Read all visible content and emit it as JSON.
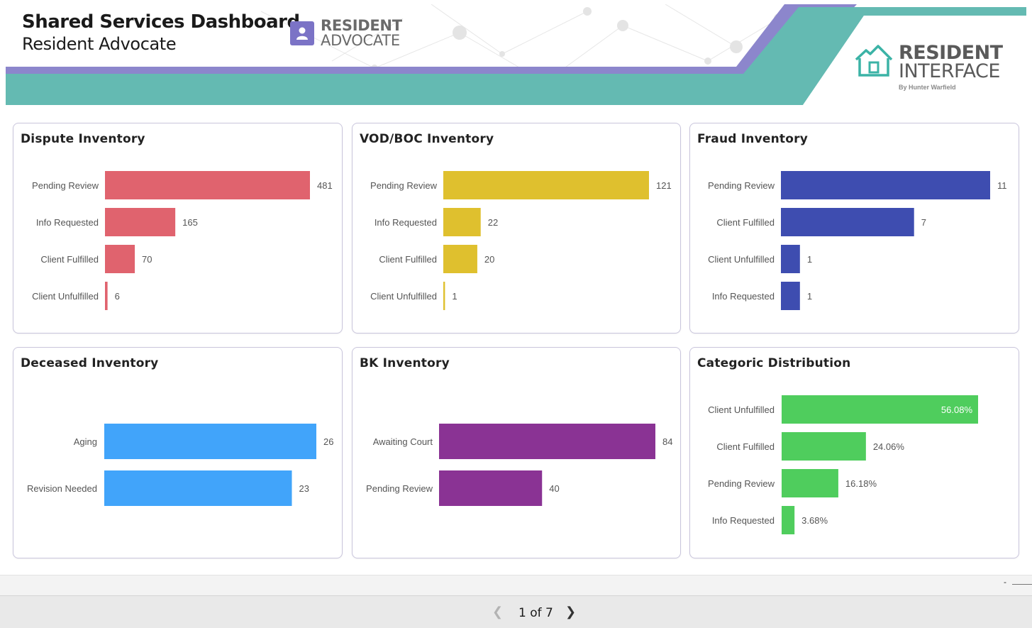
{
  "header": {
    "title": "Shared Services Dashboard",
    "subtitle": "Resident Advocate",
    "ra_logo": {
      "line1": "RESIDENT",
      "line2": "ADVOCATE",
      "icon": "user-badge-icon"
    },
    "ri_logo": {
      "line1": "RESIDENT",
      "line2": "INTERFACE",
      "tagline": "By Hunter Warfield",
      "icon": "house-icon"
    },
    "colors": {
      "purple_band": "#8c86cc",
      "teal_band": "#64bab2"
    }
  },
  "cards": [
    {
      "title": "Dispute Inventory",
      "chart_data": {
        "type": "bar",
        "orientation": "horizontal",
        "color": "#e0636e",
        "categories": [
          "Pending Review",
          "Info Requested",
          "Client Fulfilled",
          "Client Unfulfilled"
        ],
        "values": [
          481,
          165,
          70,
          6
        ],
        "labels": [
          "481",
          "165",
          "70",
          "6"
        ],
        "xlim": [
          0,
          481
        ]
      }
    },
    {
      "title": "VOD/BOC Inventory",
      "chart_data": {
        "type": "bar",
        "orientation": "horizontal",
        "color": "#dfc02e",
        "categories": [
          "Pending Review",
          "Info Requested",
          "Client Fulfilled",
          "Client Unfulfilled"
        ],
        "values": [
          121,
          22,
          20,
          1
        ],
        "labels": [
          "121",
          "22",
          "20",
          "1"
        ],
        "xlim": [
          0,
          121
        ]
      }
    },
    {
      "title": "Fraud Inventory",
      "chart_data": {
        "type": "bar",
        "orientation": "horizontal",
        "color": "#3e4db0",
        "categories": [
          "Pending Review",
          "Client Fulfilled",
          "Client Unfulfilled",
          "Info Requested"
        ],
        "values": [
          11,
          7,
          1,
          1
        ],
        "labels": [
          "11",
          "7",
          "1",
          "1"
        ],
        "xlim": [
          0,
          11
        ]
      }
    },
    {
      "title": "Deceased Inventory",
      "chart_data": {
        "type": "bar",
        "orientation": "horizontal",
        "color": "#41a4fa",
        "categories": [
          "Aging",
          "Revision Needed"
        ],
        "values": [
          26,
          23
        ],
        "labels": [
          "26",
          "23"
        ],
        "xlim": [
          0,
          26
        ]
      }
    },
    {
      "title": "BK Inventory",
      "chart_data": {
        "type": "bar",
        "orientation": "horizontal",
        "color": "#8a3394",
        "categories": [
          "Awaiting Court",
          "Pending Review"
        ],
        "values": [
          84,
          40
        ],
        "labels": [
          "84",
          "40"
        ],
        "xlim": [
          0,
          84
        ]
      }
    },
    {
      "title": "Categoric Distribution",
      "chart_data": {
        "type": "bar",
        "orientation": "horizontal",
        "color": "#4fcd5d",
        "categories": [
          "Client Unfulfilled",
          "Client Fulfilled",
          "Pending Review",
          "Info Requested"
        ],
        "values": [
          56.08,
          24.06,
          16.18,
          3.68
        ],
        "labels": [
          "56.08%",
          "24.06%",
          "16.18%",
          "3.68%"
        ],
        "inside_first_label": true,
        "xlim": [
          0,
          56.08
        ]
      }
    }
  ],
  "footer": {
    "dash_mark": "-",
    "pager": {
      "label": "1 of 7",
      "prev_icon": "chevron-left-icon",
      "next_icon": "chevron-right-icon"
    }
  }
}
